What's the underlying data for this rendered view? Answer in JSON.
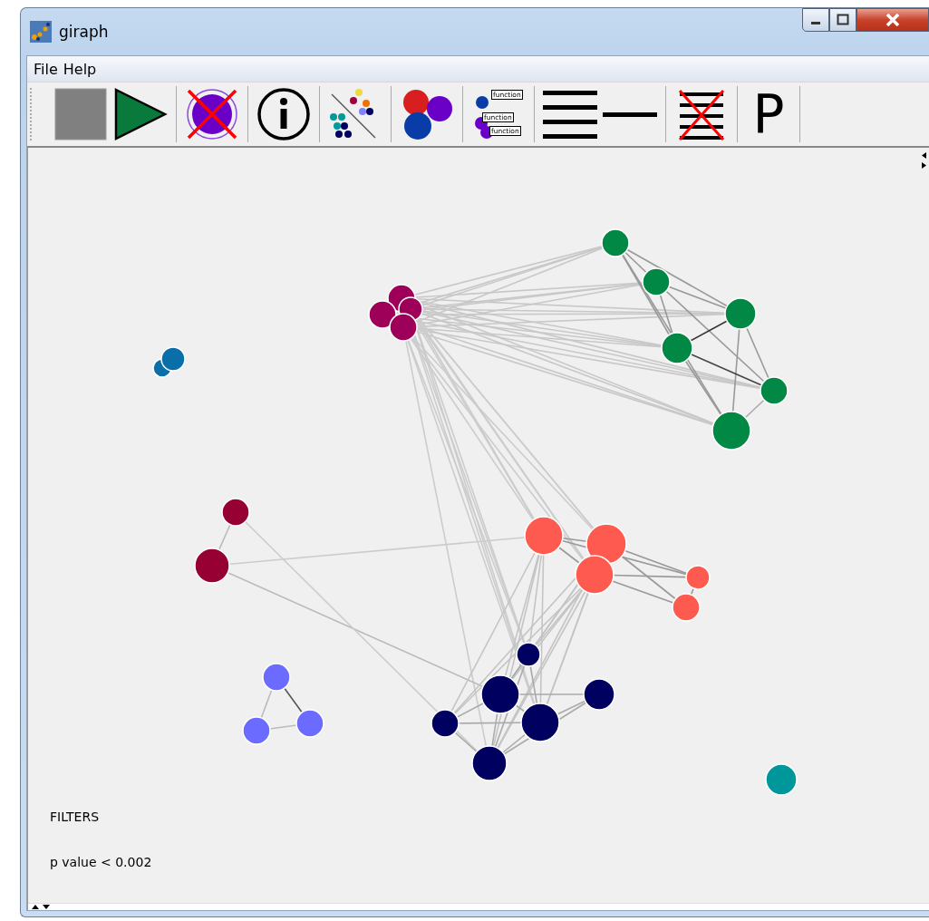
{
  "window": {
    "title": "giraph"
  },
  "menu": [
    {
      "label": "File"
    },
    {
      "label": "Help"
    }
  ],
  "toolbar": [
    {
      "kind": "stop"
    },
    {
      "kind": "play"
    },
    {
      "kind": "clear"
    },
    {
      "kind": "info"
    },
    {
      "kind": "scatter"
    },
    {
      "kind": "cluster"
    },
    {
      "kind": "functions",
      "labels": [
        "function",
        "function",
        "function"
      ]
    },
    {
      "kind": "lines"
    },
    {
      "kind": "line"
    },
    {
      "kind": "strike-lines"
    },
    {
      "kind": "letter",
      "text": "P"
    }
  ],
  "filters": {
    "heading": "FILTERS",
    "items": [
      "p value < 0.002"
    ]
  }
}
